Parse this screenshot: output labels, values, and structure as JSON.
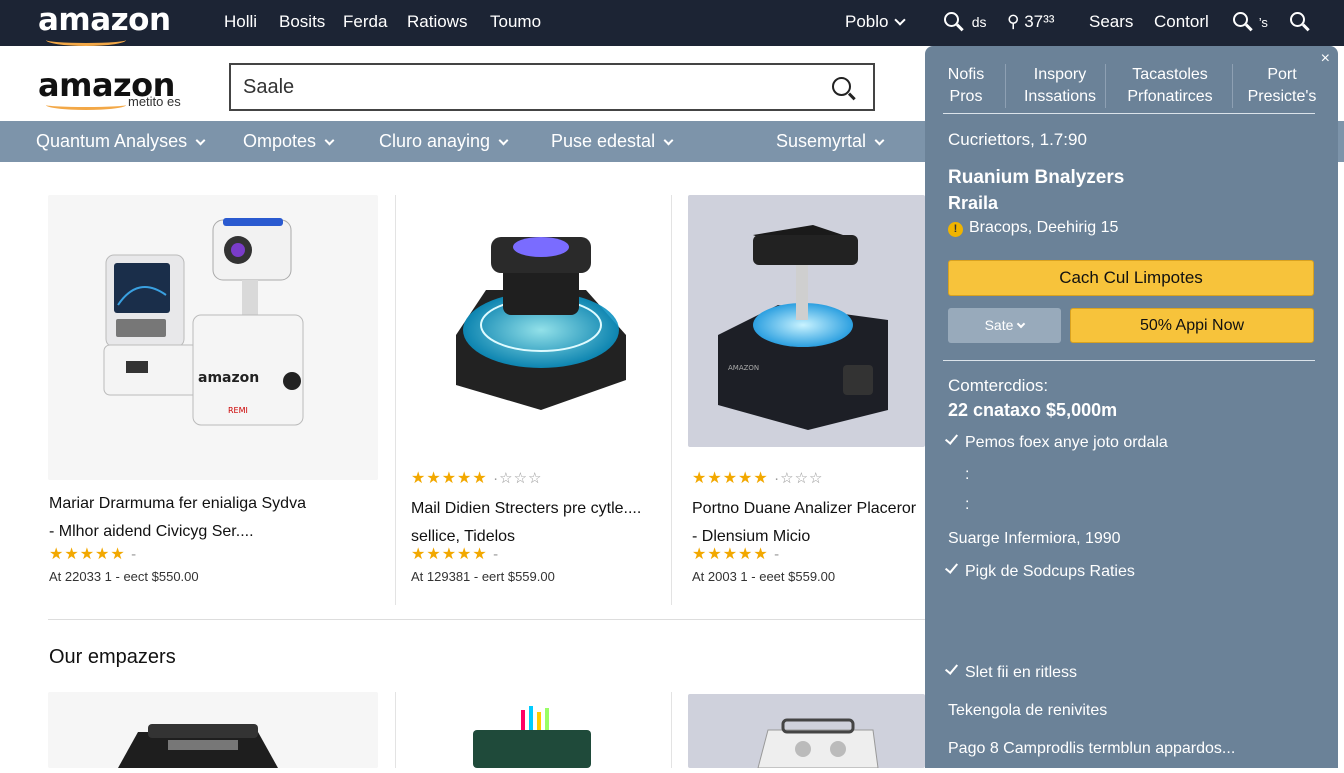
{
  "colors": {
    "topbar": "#1c2434",
    "catbar": "#7d94aa",
    "panel": "#6b8298",
    "accent_yellow": "#f7c33b",
    "star": "#f2a800",
    "logo_smile": "#f3a847"
  },
  "topbar": {
    "logo": "amazon",
    "nav": [
      "Holli",
      "Bosits",
      "Ferda",
      "Ratiows",
      "Toumo"
    ],
    "right": {
      "account": "Poblo",
      "search_count": "ds",
      "key_count": "37³³",
      "searches": "Sears",
      "control": "Contorl",
      "icon_extra": "’s"
    }
  },
  "header": {
    "logo": "amazon",
    "logo_sub": "metito es"
  },
  "search": {
    "value": "Saale",
    "placeholder": "Saale"
  },
  "categories": [
    {
      "label": "Quantum Analyses"
    },
    {
      "label": "Ompotes"
    },
    {
      "label": "Cluro anaying"
    },
    {
      "label": "Puse edestal"
    },
    {
      "label": "Susemyrtal"
    }
  ],
  "products": [
    {
      "title_line1": "Mariar Drarmuma fer enialiga Sydva",
      "title_line2": "- Mlhor aidend Civicyg Ser....",
      "stars": "★★★★★",
      "empty_stars": "-",
      "price": "At 22033 1 - eect $550.00"
    },
    {
      "title_line1": "Mail Didien Strecters pre cytle....",
      "title_line2": "sellice, Tidelos",
      "stars": "★★★★★",
      "empty_stars": "-",
      "price": "At 129381 - eert $559.00",
      "top_stars": "★★★★★",
      "top_empty": "·☆☆☆"
    },
    {
      "title_line1": "Portno Duane Analizer Placeror",
      "title_line2": "- Dlensium Micio",
      "stars": "★★★★★",
      "empty_stars": "-",
      "price": "At 2003 1 - eeet $559.00",
      "top_stars": "★★★★★",
      "top_empty": "·☆☆☆"
    }
  ],
  "section_title": "Our empazers",
  "panel": {
    "close": "×",
    "tabs": [
      {
        "line1": "Nofis",
        "line2": "Pros"
      },
      {
        "line1": "Inspory",
        "line2": "Inssations"
      },
      {
        "line1": "Tacastoles",
        "line2": "Prfonatirces"
      },
      {
        "line1": "Port",
        "line2": "Presicte's"
      }
    ],
    "customers": "Cucriettors, 1.7:90",
    "product_name": "Ruanium Bnalyzers",
    "product_sub": "Rraila",
    "notice_icon": "!",
    "notice": "Bracops, Deehirig 15",
    "primary_button": "Cach Cul Limpotes",
    "select_label": "Sate",
    "secondary_button": "50% Appi Now",
    "comments_label": "Comtercdios:",
    "comments_value": "22 cnataxo $5,000m",
    "check1": "Pemos foex anye joto ordala",
    "colon1": ":",
    "colon2": ":",
    "info_line": "Suarge Infermiora, 1990",
    "check2": "Pigk de Sodcups Raties",
    "check3": "Slet fii en ritless",
    "line_a": "Tekengola de renivites",
    "line_b": "Pago 8 Camprodlis termblun appardos..."
  }
}
